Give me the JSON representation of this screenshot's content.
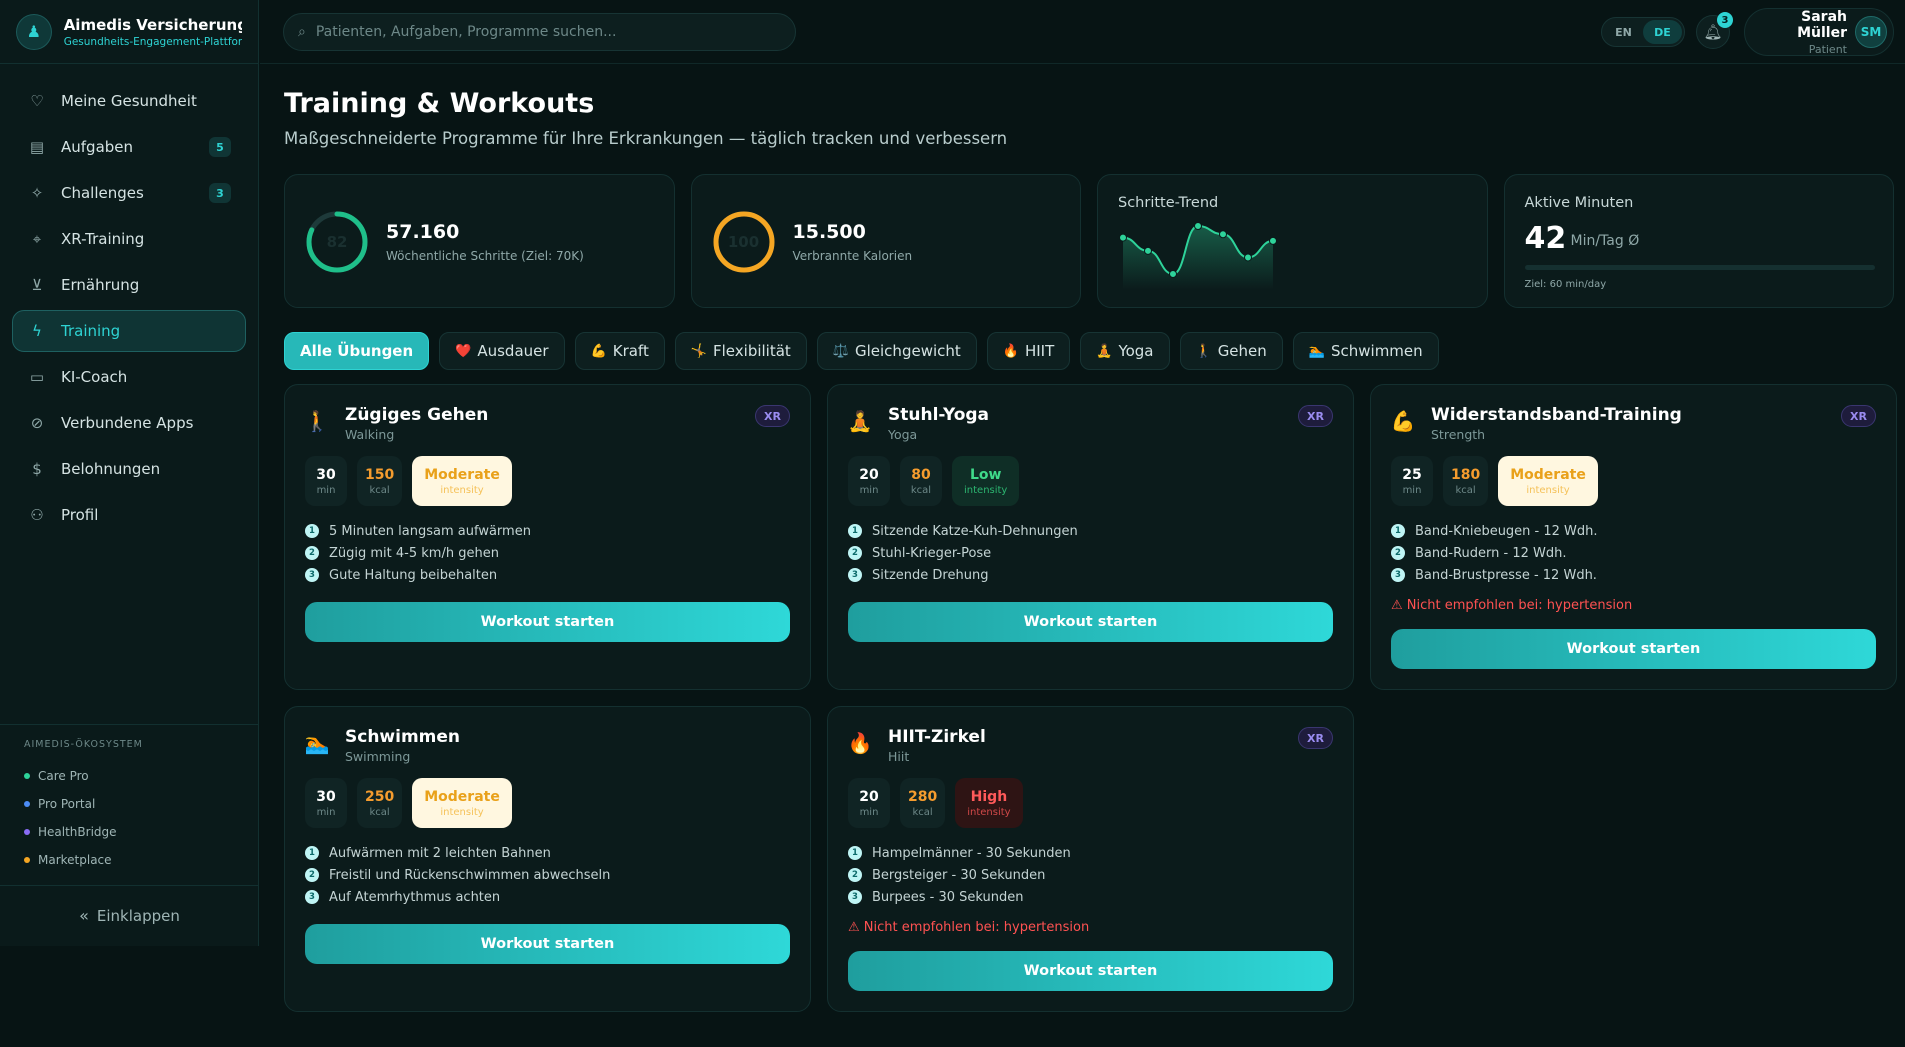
{
  "brand": {
    "title": "Aimedis Versicherung",
    "subtitle": "Gesundheits-Engagement-Plattform"
  },
  "nav": [
    {
      "label": "Meine Gesundheit",
      "icon": "heart-icon",
      "glyph": "♡"
    },
    {
      "label": "Aufgaben",
      "icon": "clipboard-icon",
      "glyph": "▤",
      "badge": "5"
    },
    {
      "label": "Challenges",
      "icon": "sparkle-icon",
      "glyph": "✧",
      "badge": "3"
    },
    {
      "label": "XR-Training",
      "icon": "xr-icon",
      "glyph": "⌖"
    },
    {
      "label": "Ernährung",
      "icon": "cart-icon",
      "glyph": "⊻"
    },
    {
      "label": "Training",
      "icon": "bolt-icon",
      "glyph": "ϟ",
      "active": true
    },
    {
      "label": "KI-Coach",
      "icon": "monitor-icon",
      "glyph": "▭"
    },
    {
      "label": "Verbundene Apps",
      "icon": "link-icon",
      "glyph": "⊘"
    },
    {
      "label": "Belohnungen",
      "icon": "coin-icon",
      "glyph": "$"
    },
    {
      "label": "Profil",
      "icon": "user-icon",
      "glyph": "⚇"
    }
  ],
  "ecosystem": {
    "title": "AIMEDIS-ÖKOSYSTEM",
    "items": [
      {
        "label": "Care Pro",
        "color": "#2ed39a"
      },
      {
        "label": "Pro Portal",
        "color": "#4c8cf5"
      },
      {
        "label": "HealthBridge",
        "color": "#8a6cf5"
      },
      {
        "label": "Marketplace",
        "color": "#f5a623"
      }
    ]
  },
  "collapse_label": "Einklappen",
  "header": {
    "search_placeholder": "Patienten, Aufgaben, Programme suchen...",
    "lang": {
      "en": "EN",
      "de": "DE",
      "active": "DE"
    },
    "notifications": "3",
    "user_name": "Sarah Müller",
    "user_role": "Patient",
    "user_initials": "SM"
  },
  "page": {
    "title": "Training & Workouts",
    "subtitle": "Maßgeschneiderte Programme für Ihre Erkrankungen — täglich tracken und verbessern"
  },
  "stats": {
    "steps": {
      "value": "57.160",
      "label": "Wöchentliche Schritte (Ziel: 70K)",
      "ring_text": "82",
      "progress": 0.82
    },
    "calories": {
      "value": "15.500",
      "label": "Verbrannte Kalorien",
      "ring_text": "100",
      "progress": 1.0
    },
    "trend": {
      "title": "Schritte-Trend",
      "values": [
        7800,
        7000,
        5600,
        8500,
        8000,
        6600,
        7600
      ]
    },
    "active": {
      "title": "Aktive Minuten",
      "value": "42",
      "unit": "Min/Tag Ø",
      "goal": "Ziel: 60 min/day",
      "progress": 0.0
    }
  },
  "filters": [
    {
      "label": "Alle Übungen",
      "icon": "",
      "active": true
    },
    {
      "label": "Ausdauer",
      "icon": "❤️"
    },
    {
      "label": "Kraft",
      "icon": "💪"
    },
    {
      "label": "Flexibilität",
      "icon": "🤸"
    },
    {
      "label": "Gleichgewicht",
      "icon": "⚖️"
    },
    {
      "label": "HIIT",
      "icon": "🔥"
    },
    {
      "label": "Yoga",
      "icon": "🧘"
    },
    {
      "label": "Gehen",
      "icon": "🚶"
    },
    {
      "label": "Schwimmen",
      "icon": "🏊"
    }
  ],
  "workouts": [
    {
      "title": "Zügiges Gehen",
      "category": "Walking",
      "icon": "🚶",
      "icon_name": "walking-icon",
      "xr": "XR",
      "min": "30",
      "min_unit": "min",
      "kcal": "150",
      "kcal_unit": "kcal",
      "intensity": "Moderate",
      "intensity_unit": "intensity",
      "level": "moderate",
      "steps": [
        "5 Minuten langsam aufwärmen",
        "Zügig mit 4-5 km/h gehen",
        "Gute Haltung beibehalten"
      ],
      "warning": "",
      "button": "Workout starten"
    },
    {
      "title": "Stuhl-Yoga",
      "category": "Yoga",
      "icon": "🧘",
      "icon_name": "yoga-icon",
      "xr": "XR",
      "min": "20",
      "min_unit": "min",
      "kcal": "80",
      "kcal_unit": "kcal",
      "intensity": "Low",
      "intensity_unit": "intensity",
      "level": "low",
      "steps": [
        "Sitzende Katze-Kuh-Dehnungen",
        "Stuhl-Krieger-Pose",
        "Sitzende Drehung"
      ],
      "warning": "",
      "button": "Workout starten"
    },
    {
      "title": "Widerstandsband-Training",
      "category": "Strength",
      "icon": "💪",
      "icon_name": "muscle-icon",
      "xr": "XR",
      "min": "25",
      "min_unit": "min",
      "kcal": "180",
      "kcal_unit": "kcal",
      "intensity": "Moderate",
      "intensity_unit": "intensity",
      "level": "moderate",
      "steps": [
        "Band-Kniebeugen - 12 Wdh.",
        "Band-Rudern - 12 Wdh.",
        "Band-Brustpresse - 12 Wdh."
      ],
      "warning": "⚠ Nicht empfohlen bei: hypertension",
      "button": "Workout starten"
    },
    {
      "title": "Schwimmen",
      "category": "Swimming",
      "icon": "🏊",
      "icon_name": "swimming-icon",
      "xr": "",
      "min": "30",
      "min_unit": "min",
      "kcal": "250",
      "kcal_unit": "kcal",
      "intensity": "Moderate",
      "intensity_unit": "intensity",
      "level": "moderate",
      "steps": [
        "Aufwärmen mit 2 leichten Bahnen",
        "Freistil und Rückenschwimmen abwechseln",
        "Auf Atemrhythmus achten"
      ],
      "warning": "",
      "button": "Workout starten"
    },
    {
      "title": "HIIT-Zirkel",
      "category": "Hiit",
      "icon": "🔥",
      "icon_name": "fire-icon",
      "xr": "XR",
      "min": "20",
      "min_unit": "min",
      "kcal": "280",
      "kcal_unit": "kcal",
      "intensity": "High",
      "intensity_unit": "intensity",
      "level": "high",
      "steps": [
        "Hampelmänner - 30 Sekunden",
        "Bergsteiger - 30 Sekunden",
        "Burpees - 30 Sekunden"
      ],
      "warning": "⚠ Nicht empfohlen bei: hypertension",
      "button": "Workout starten"
    }
  ],
  "colors": {
    "accent": "#2ed3d3",
    "background": "#071414",
    "card": "#0b1b1b",
    "warning": "#ff5252",
    "kcal": "#f59c2e"
  }
}
